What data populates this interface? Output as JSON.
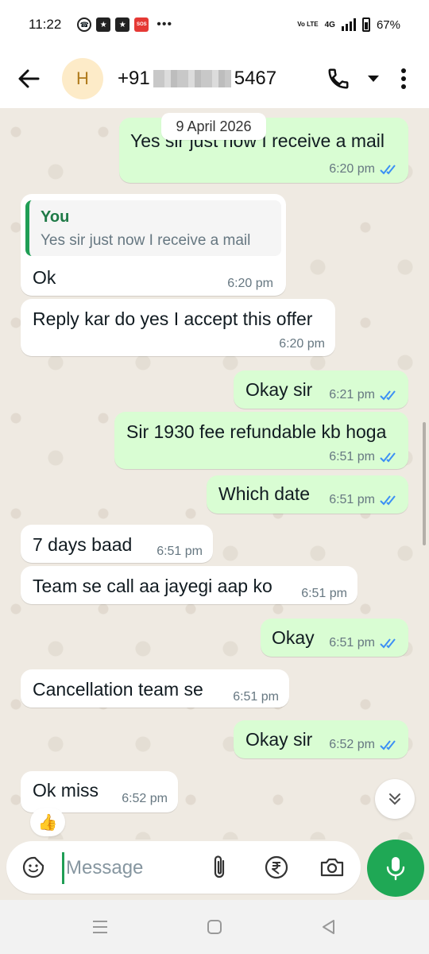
{
  "status_bar": {
    "time": "11:22",
    "network": "4G",
    "volte": "Vo LTE",
    "battery": "67%",
    "battery_level": 0.67,
    "more": "•••",
    "sos": "SOS"
  },
  "header": {
    "avatar_letter": "H",
    "contact_prefix": "+91",
    "contact_suffix": "5467",
    "icons": [
      "back-arrow-icon",
      "phone-icon",
      "dropdown-arrow-icon",
      "more-vert-icon"
    ]
  },
  "chat": {
    "date_chip": "9 April 2026",
    "messages": [
      {
        "dir": "out",
        "text": "Yes sir just now I receive a mail",
        "time": "6:20 pm",
        "read": true
      },
      {
        "dir": "in",
        "quote_author": "You",
        "quote_text": "Yes sir just now I receive a mail",
        "text": "Ok",
        "time": "6:20 pm"
      },
      {
        "dir": "in",
        "text": "Reply kar do yes I accept this offer",
        "time": "6:20 pm"
      },
      {
        "dir": "out",
        "text": "Okay sir",
        "time": "6:21 pm",
        "read": true
      },
      {
        "dir": "out",
        "text": "Sir 1930 fee refundable kb hoga",
        "time": "6:51 pm",
        "read": true
      },
      {
        "dir": "out",
        "text": "Which date",
        "time": "6:51 pm",
        "read": true
      },
      {
        "dir": "in",
        "text": "7 days baad",
        "time": "6:51 pm"
      },
      {
        "dir": "in",
        "text": "Team se call aa jayegi aap ko",
        "time": "6:51 pm"
      },
      {
        "dir": "out",
        "text": "Okay",
        "time": "6:51 pm",
        "read": true
      },
      {
        "dir": "in",
        "text": "Cancellation team se",
        "time": "6:51 pm"
      },
      {
        "dir": "out",
        "text": "Okay sir",
        "time": "6:52 pm",
        "read": true
      },
      {
        "dir": "in",
        "text": "Ok miss",
        "time": "6:52 pm",
        "reaction": "👍"
      }
    ]
  },
  "input": {
    "placeholder": "Message",
    "icons": [
      "sticker-icon",
      "attach-icon",
      "rupee-icon",
      "camera-icon",
      "mic-icon"
    ]
  },
  "colors": {
    "outgoing_bubble": "#d9fdd3",
    "incoming_bubble": "#ffffff",
    "accent_green": "#1fa855",
    "read_ticks": "#3b8ff5",
    "chat_background": "#efeae2"
  }
}
